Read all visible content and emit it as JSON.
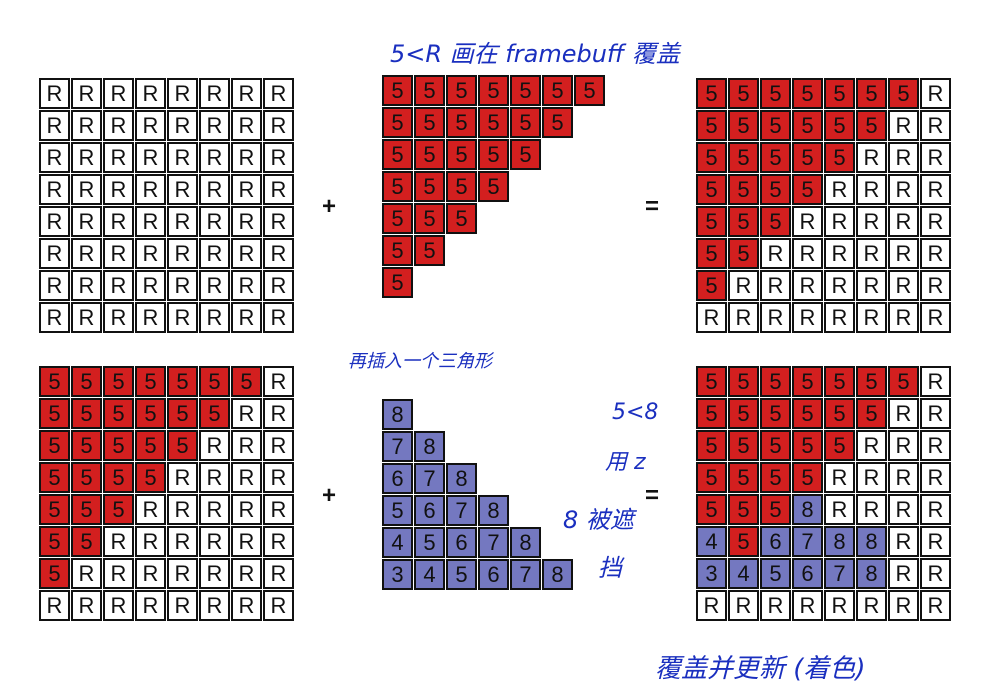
{
  "grids": [
    {
      "id": "grid-top-left",
      "rows": [
        "RRRRRRRR",
        "RRRRRRRR",
        "RRRRRRRR",
        "RRRRRRRR",
        "RRRRRRRR",
        "RRRRRRRR",
        "RRRRRRRR",
        "RRRRRRRR"
      ]
    },
    {
      "id": "grid-top-middle",
      "rows": [
        "5555555.",
        "555555..",
        "55555...",
        "5555....",
        "555.....",
        "55......",
        "5.......",
        "........"
      ]
    },
    {
      "id": "grid-top-right",
      "rows": [
        "5555555R",
        "555555RR",
        "55555RRR",
        "5555RRRR",
        "555RRRRR",
        "55RRRRRR",
        "5RRRRRRR",
        "RRRRRRRR"
      ]
    },
    {
      "id": "grid-bottom-left",
      "rows": [
        "5555555R",
        "555555RR",
        "55555RRR",
        "5555RRRR",
        "555RRRRR",
        "55RRRRRR",
        "5RRRRRRR",
        "RRRRRRRR"
      ]
    },
    {
      "id": "grid-bottom-middle",
      "rows": [
        "........",
        "8.......",
        "78......",
        "678.....",
        "5678....",
        "45678...",
        "345678..",
        "........"
      ]
    },
    {
      "id": "grid-bottom-right",
      "rows": [
        "5555555R",
        "555555RR",
        "55555RRR",
        "5555RRRR",
        "5558RRRR",
        "456788RR",
        "345678RR",
        "RRRRRRRR"
      ]
    }
  ],
  "blue_cells_bottom_right": [
    [
      4,
      3
    ],
    [
      5,
      0
    ],
    [
      5,
      2
    ],
    [
      5,
      3
    ],
    [
      5,
      4
    ],
    [
      5,
      5
    ],
    [
      6,
      0
    ],
    [
      6,
      1
    ],
    [
      6,
      2
    ],
    [
      6,
      3
    ],
    [
      6,
      4
    ],
    [
      6,
      5
    ]
  ],
  "operators": {
    "plus": "+",
    "equals": "="
  },
  "annotations": {
    "top": "5<R  画在 framebuff  覆盖",
    "middle": "再插入一个三角形",
    "right_1": "5<8",
    "right_2": "用 z",
    "right_3": "8 被遮",
    "right_4": "挡",
    "bottom": "覆盖并更新 (着色)"
  },
  "colors": {
    "red": "#d31f1f",
    "blue": "#7478c0",
    "ink": "#1a2fbf"
  }
}
